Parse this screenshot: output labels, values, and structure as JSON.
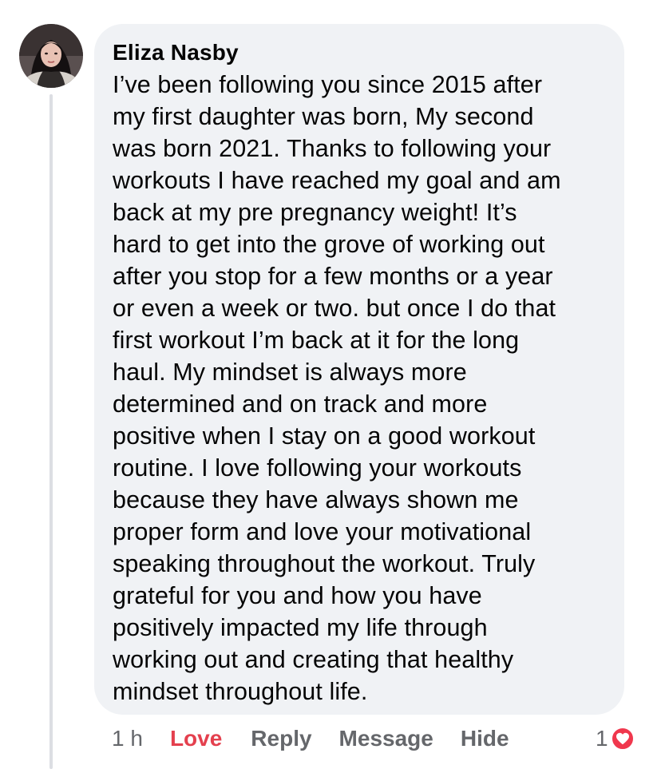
{
  "comment": {
    "author": "Eliza Nasby",
    "text": "I’ve been following you since 2015 after\nmy first daughter was born, My second\nwas born 2021. Thanks to following your\nworkouts I have reached my goal and am\nback at my pre pregnancy weight! It’s\nhard to get into the grove of working out\nafter you stop for a few months or a year\nor even a week or two. but once I do that\nfirst workout I’m back at it for the long\nhaul. My mindset is always more\ndetermined and on track and more\npositive when I stay on a good workout\nroutine. I love following your workouts\nbecause they have always shown me\nproper form and love your motivational\nspeaking throughout the workout. Truly\ngrateful for you and how you have\npositively impacted my life through\nworking out and creating that healthy\nmindset throughout life.",
    "time": "1 h",
    "reaction_count": "1",
    "reaction_icon": "heart-icon"
  },
  "actions": {
    "love_label": "Love",
    "reply_label": "Reply",
    "message_label": "Message",
    "hide_label": "Hide"
  },
  "colors": {
    "bubble": "#f0f2f5",
    "love": "#e4404e",
    "muted": "#65676b",
    "heart_badge": "#f0374d"
  }
}
